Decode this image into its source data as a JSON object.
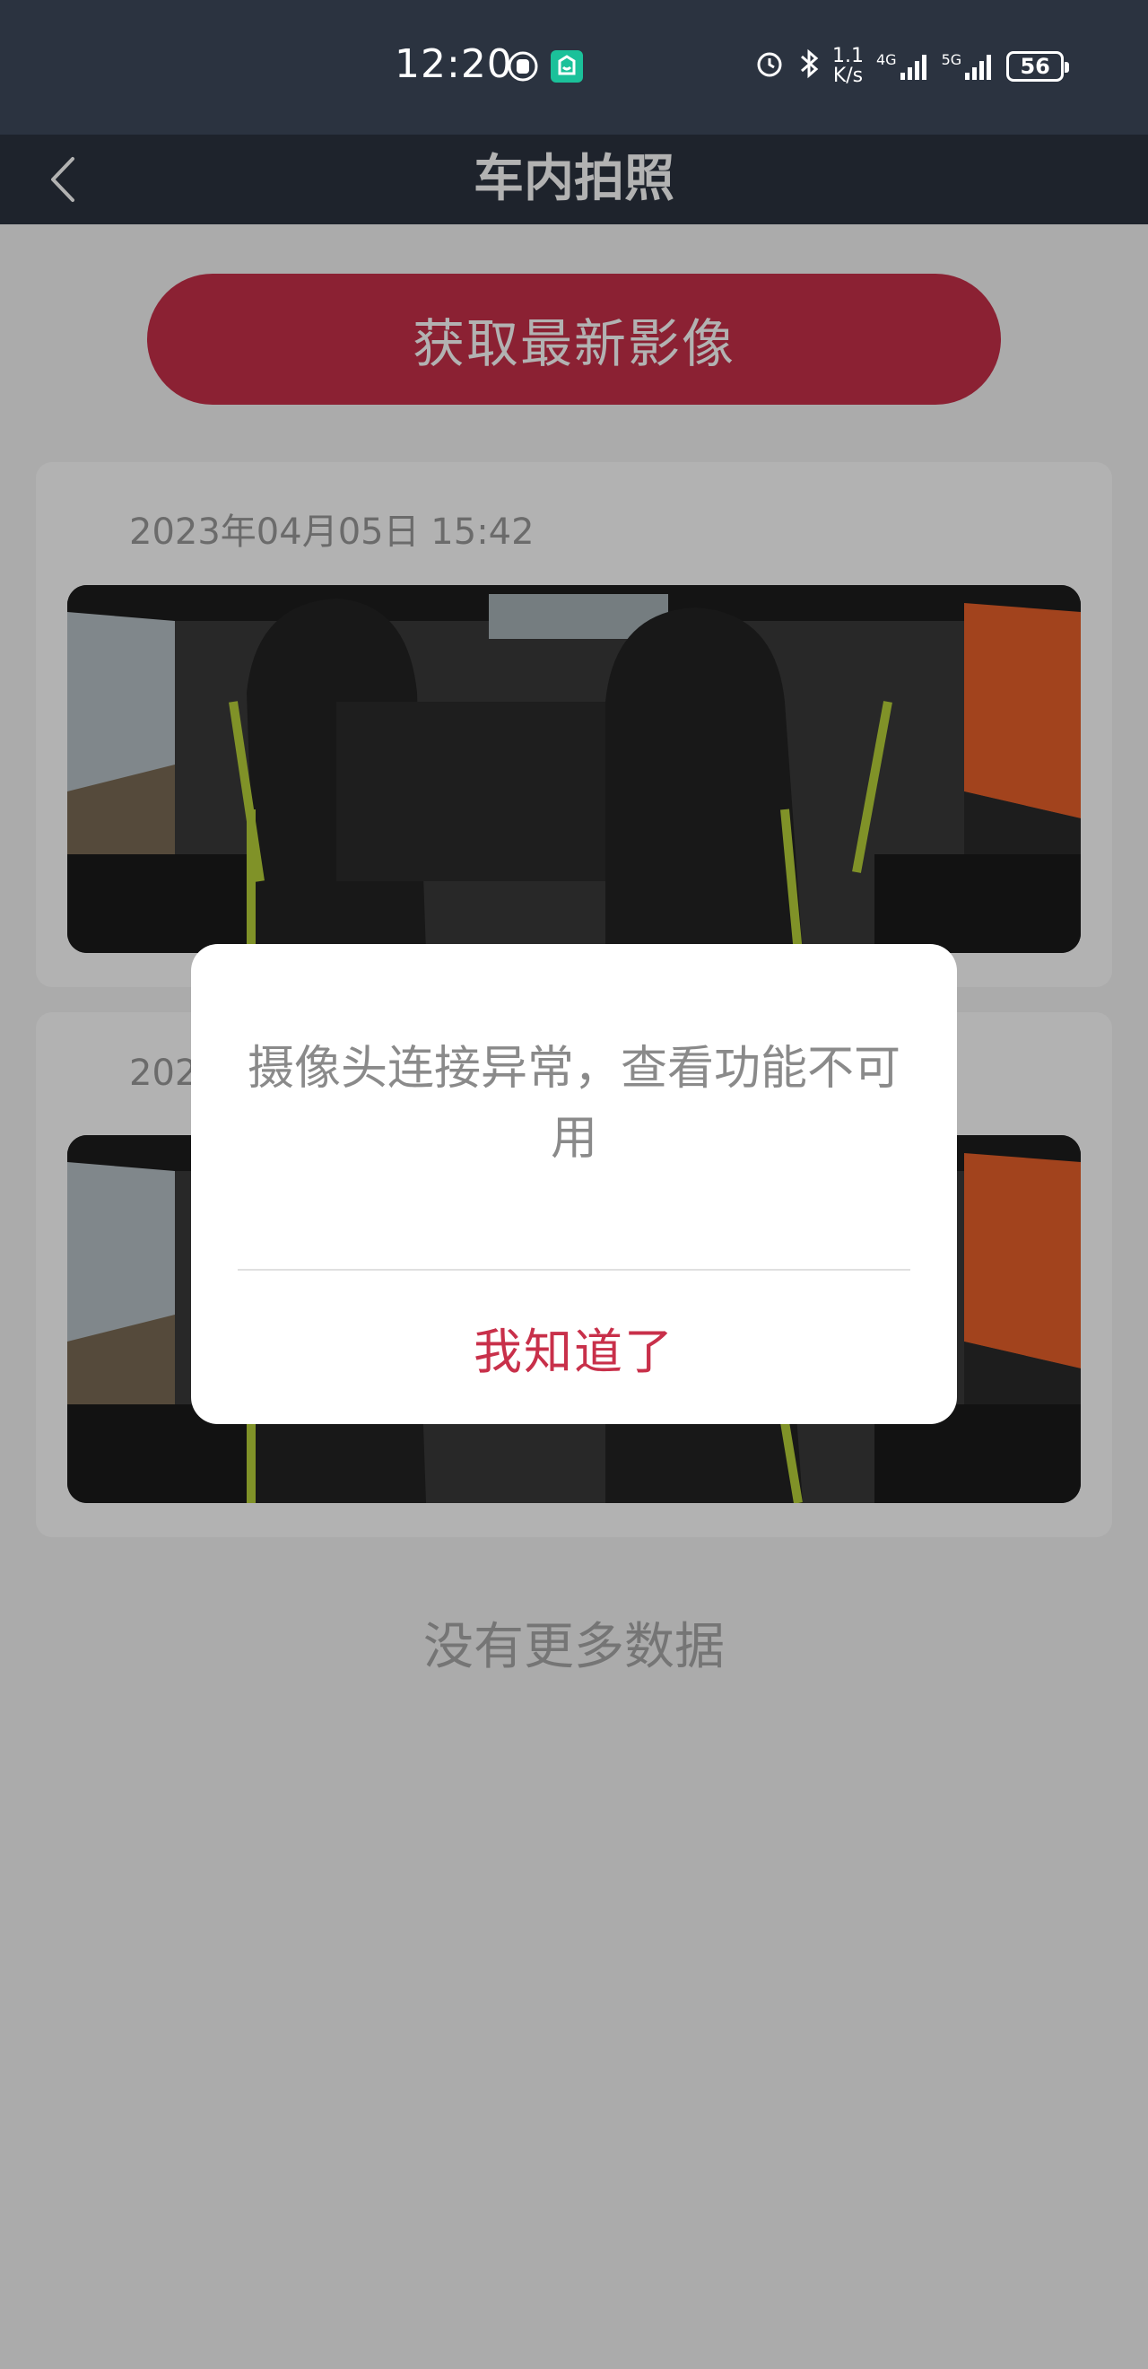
{
  "status_bar": {
    "time": "12:20",
    "network_speed": "1.1\nK/s",
    "network_speed_value": "1.1",
    "network_speed_unit": "K/s",
    "signal_1": "4G",
    "signal_2": "5G",
    "battery": "56"
  },
  "header": {
    "title": "车内拍照",
    "back_icon": "chevron-left-icon"
  },
  "actions": {
    "fetch_label": "获取最新影像"
  },
  "photos": [
    {
      "timestamp": "2023年04月05日 15:42"
    },
    {
      "timestamp": "202"
    }
  ],
  "footer": {
    "no_more": "没有更多数据"
  },
  "dialog": {
    "message": "摄像头连接异常，查看功能不可用",
    "confirm_label": "我知道了"
  },
  "colors": {
    "header_bg": "#2b3340",
    "accent": "#c8304a",
    "page_bg": "#f5f5f5"
  }
}
